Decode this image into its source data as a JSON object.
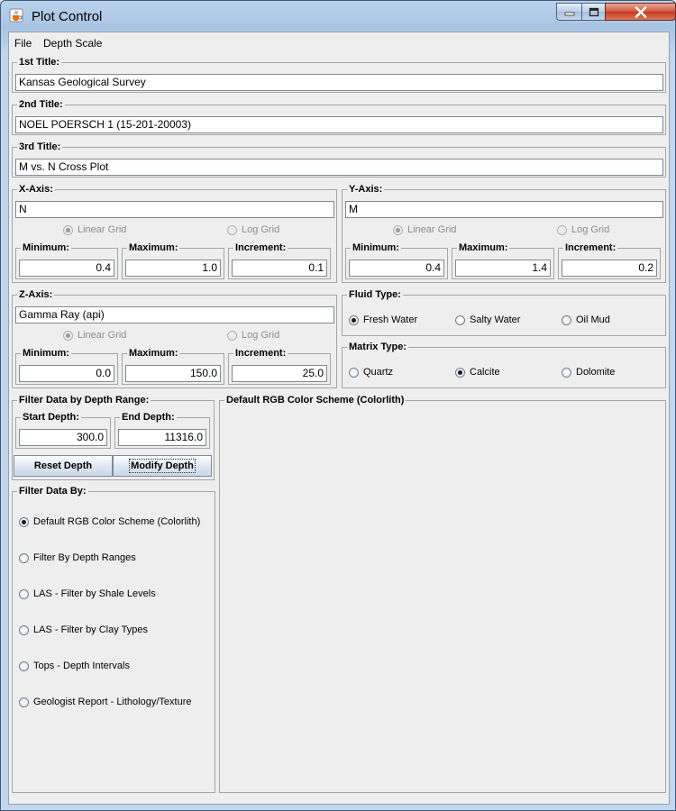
{
  "window": {
    "title": "Plot Control"
  },
  "menu": {
    "file": "File",
    "depth_scale": "Depth Scale"
  },
  "titles": {
    "first": {
      "label": "1st Title:",
      "value": "Kansas Geological Survey"
    },
    "second": {
      "label": "2nd Title:",
      "value": "NOEL POERSCH 1 (15-201-20003)"
    },
    "third": {
      "label": "3rd Title:",
      "value": "M vs. N Cross Plot"
    }
  },
  "xaxis": {
    "label": "X-Axis:",
    "value": "N",
    "linear": "Linear Grid",
    "log": "Log Grid",
    "min_label": "Minimum:",
    "min": "0.4",
    "max_label": "Maximum:",
    "max": "1.0",
    "inc_label": "Increment:",
    "inc": "0.1"
  },
  "yaxis": {
    "label": "Y-Axis:",
    "value": "M",
    "linear": "Linear Grid",
    "log": "Log Grid",
    "min_label": "Minimum:",
    "min": "0.4",
    "max_label": "Maximum:",
    "max": "1.4",
    "inc_label": "Increment:",
    "inc": "0.2"
  },
  "zaxis": {
    "label": "Z-Axis:",
    "value": "Gamma Ray (api)",
    "linear": "Linear Grid",
    "log": "Log Grid",
    "min_label": "Minimum:",
    "min": "0.0",
    "max_label": "Maximum:",
    "max": "150.0",
    "inc_label": "Increment:",
    "inc": "25.0"
  },
  "fluid": {
    "label": "Fluid Type:",
    "options": [
      "Fresh Water",
      "Salty Water",
      "Oil Mud"
    ],
    "selected": "Fresh Water"
  },
  "matrix": {
    "label": "Matrix Type:",
    "options": [
      "Quartz",
      "Calcite",
      "Dolomite"
    ],
    "selected": "Calcite"
  },
  "depth_filter": {
    "label": "Filter Data by Depth Range:",
    "start_label": "Start Depth:",
    "start": "300.0",
    "end_label": "End Depth:",
    "end": "11316.0",
    "reset": "Reset Depth",
    "modify": "Modify Depth"
  },
  "filter_by": {
    "label": "Filter Data By:",
    "options": [
      "Default RGB Color Scheme (Colorlith)",
      "Filter By Depth Ranges",
      "LAS - Filter by Shale Levels",
      "LAS - Filter by Clay Types",
      "Tops - Depth Intervals",
      "Geologist Report - Lithology/Texture"
    ],
    "selected": "Default RGB Color Scheme (Colorlith)"
  },
  "scheme_panel": {
    "label": "Default RGB Color Scheme (Colorlith)"
  },
  "icons": {
    "app": "java-cup-icon",
    "minimize": "minimize-icon",
    "maximize": "maximize-icon",
    "close": "close-icon"
  }
}
